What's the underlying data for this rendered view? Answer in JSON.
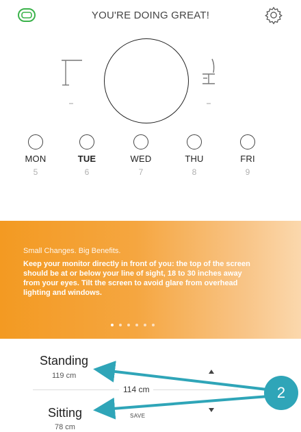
{
  "header": {
    "title": "YOU'RE DOING GREAT!",
    "brand_icon": "battery-link-icon",
    "settings_icon": "gear-icon"
  },
  "status": {
    "standing_icon": "standing-desk-icon",
    "sitting_icon": "office-chair-icon"
  },
  "days": [
    {
      "label": "MON",
      "num": "5",
      "bold": false
    },
    {
      "label": "TUE",
      "num": "6",
      "bold": true
    },
    {
      "label": "WED",
      "num": "7",
      "bold": false
    },
    {
      "label": "THU",
      "num": "8",
      "bold": false
    },
    {
      "label": "FRI",
      "num": "9",
      "bold": false
    }
  ],
  "tip": {
    "kicker": "Small Changes. Big Benefits.",
    "body": "Keep your monitor directly in front of you: the top of the screen should be at or below your line of sight, 18 to 30 inches away from your eyes. Tilt the screen to avoid glare from overhead lighting and windows.",
    "page_count": 6,
    "active_page": 0
  },
  "controls": {
    "standing_label": "Standing",
    "standing_value": "119 cm",
    "sitting_label": "Sitting",
    "sitting_value": "78 cm",
    "current_height": "114 cm",
    "save_label": "SAVE"
  },
  "annotation": {
    "number": "2",
    "color": "#2fa5b8"
  },
  "colors": {
    "banner_start": "#f39a22",
    "banner_end": "#fbd8ad",
    "callout": "#2fa5b8"
  }
}
